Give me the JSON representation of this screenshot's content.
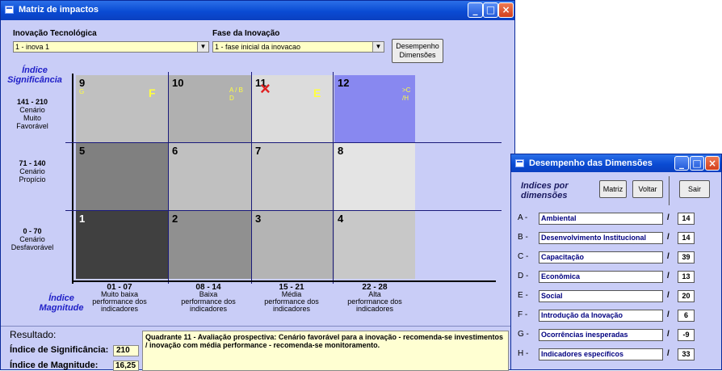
{
  "main_window": {
    "title": "Matriz de impactos",
    "label_inovacao": "Inovação Tecnológica",
    "label_fase": "Fase da Inovação",
    "inovacao_value": "1 - inova 1",
    "fase_value": "1 - fase inicial da inovacao",
    "btn_desempenho_l1": "Desempenho",
    "btn_desempenho_l2": "Dimensões",
    "y_axis_title_l1": "Índice",
    "y_axis_title_l2": "Significância",
    "x_axis_title_l1": "Índice",
    "x_axis_title_l2": "Magnitude",
    "rows": [
      {
        "range": "141 - 210",
        "l1": "Cenário",
        "l2": "Muito",
        "l3": "Favorável"
      },
      {
        "range": "71 - 140",
        "l1": "Cenário",
        "l2": "Propício",
        "l3": ""
      },
      {
        "range": "0 - 70",
        "l1": "Cenário",
        "l2": "Desfavorável",
        "l3": ""
      }
    ],
    "cols": [
      {
        "range": "01 - 07",
        "l1": "Muito baixa",
        "l2": "performance dos",
        "l3": "indicadores"
      },
      {
        "range": "08 - 14",
        "l1": "Baixa",
        "l2": "performance dos",
        "l3": "indicadores"
      },
      {
        "range": "15 - 21",
        "l1": "Média",
        "l2": "performance dos",
        "l3": "indicadores"
      },
      {
        "range": "22 - 28",
        "l1": "Alta",
        "l2": "performance dos",
        "l3": "indicadores"
      }
    ],
    "cells": [
      {
        "n": "9",
        "color": "#c0c0c0",
        "tag": "G",
        "big": "F"
      },
      {
        "n": "10",
        "color": "#b0b0b0",
        "tag": "A / B",
        "tag2": "D"
      },
      {
        "n": "11",
        "color": "#dcdcdc",
        "mark": "×",
        "big": "E"
      },
      {
        "n": "12",
        "color": "#8888f0",
        "tag": ">C",
        "tag2": "/H"
      },
      {
        "n": "5",
        "color": "#808080"
      },
      {
        "n": "6",
        "color": "#c0c0c0"
      },
      {
        "n": "7",
        "color": "#c8c8c8"
      },
      {
        "n": "8",
        "color": "#e4e4e4"
      },
      {
        "n": "1",
        "color": "#404040"
      },
      {
        "n": "2",
        "color": "#909090"
      },
      {
        "n": "3",
        "color": "#b4b4b4"
      },
      {
        "n": "4",
        "color": "#c8c8c8"
      }
    ],
    "resultado_label": "Resultado:",
    "sig_label": "Índice de Significância:",
    "sig_value": "210",
    "mag_label": "Índice de Magnitude:",
    "mag_value": "16,25",
    "result_text": "Quadrante 11 - Avaliação prospectiva: Cenário favorável para a inovação - recomenda-se investimentos / inovação com média performance - recomenda-se monitoramento."
  },
  "dim_window": {
    "title": "Desempenho das Dimensões",
    "heading_l1": "Indices por",
    "heading_l2": "dimensões",
    "btn_matriz": "Matriz",
    "btn_voltar": "Voltar",
    "btn_sair": "Sair",
    "rows": [
      {
        "letter": "A -",
        "name": "Ambiental",
        "value": "14"
      },
      {
        "letter": "B -",
        "name": "Desenvolvimento Institucional",
        "value": "14"
      },
      {
        "letter": "C -",
        "name": "Capacitação",
        "value": "39"
      },
      {
        "letter": "D -",
        "name": "Econômica",
        "value": "13"
      },
      {
        "letter": "E -",
        "name": "Social",
        "value": "20"
      },
      {
        "letter": "F -",
        "name": "Introdução da Inovação",
        "value": "6"
      },
      {
        "letter": "G -",
        "name": "Ocorrências inesperadas",
        "value": "-9"
      },
      {
        "letter": "H -",
        "name": "Indicadores específicos",
        "value": "33"
      }
    ]
  },
  "colors": {
    "title_bar": "#0a4bd3",
    "form_bg": "#c9cdf7",
    "label_blue": "#2020c8",
    "mark_red": "#e02020",
    "tag_yellow": "#ffff40"
  },
  "icons": [
    "app-icon",
    "minimize-icon",
    "maximize-icon",
    "close-icon",
    "dropdown-arrow-icon",
    "cross-mark-icon"
  ]
}
